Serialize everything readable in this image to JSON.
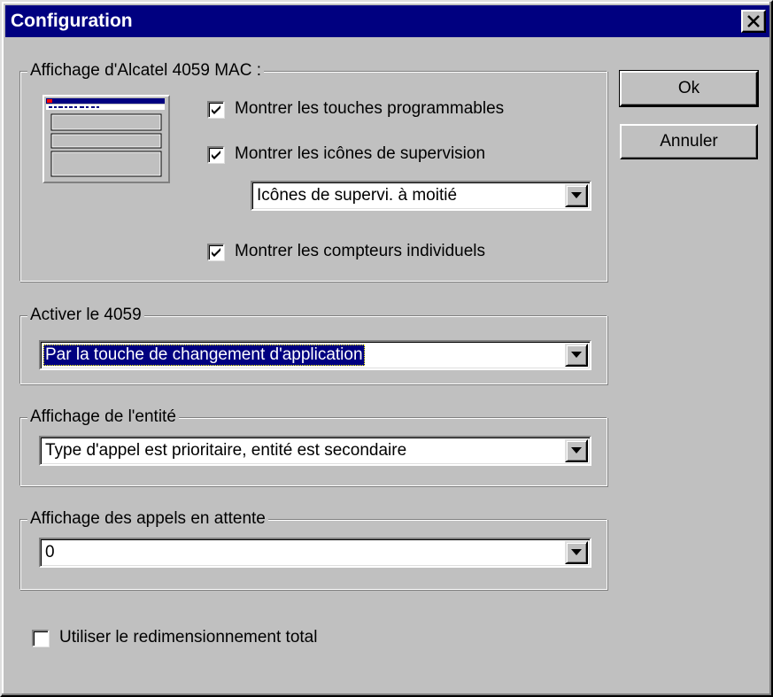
{
  "window": {
    "title": "Configuration"
  },
  "display_group": {
    "legend": "Affichage d'Alcatel 4059 MAC :",
    "show_softkeys": {
      "label": "Montrer les touches programmables",
      "checked": true
    },
    "show_supervision_icons": {
      "label": "Montrer les icônes de supervision",
      "checked": true
    },
    "supervision_mode": {
      "value": "Icônes de supervi. à moitié"
    },
    "show_counters": {
      "label": "Montrer les compteurs individuels",
      "checked": true
    }
  },
  "activate_group": {
    "legend": "Activer le 4059",
    "mode": {
      "value": "Par la touche de changement d'application"
    }
  },
  "entity_group": {
    "legend": "Affichage de l'entité",
    "mode": {
      "value": "Type d'appel est prioritaire, entité est secondaire"
    }
  },
  "waiting_group": {
    "legend": "Affichage des appels en attente",
    "count": {
      "value": "0"
    }
  },
  "full_resize": {
    "label": "Utiliser le redimensionnement total",
    "checked": false
  },
  "buttons": {
    "ok": "Ok",
    "cancel": "Annuler"
  },
  "colors": {
    "titlebar": "#000080",
    "face": "#c0c0c0",
    "selection": "#000080"
  }
}
